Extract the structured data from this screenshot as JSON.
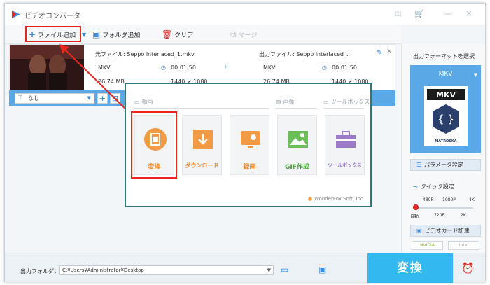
{
  "window": {
    "title": "ビデオコンバータ"
  },
  "toolbar": {
    "add_file": "ファイル追加",
    "add_folder": "フォルダ追加",
    "clear": "クリア",
    "merge": "マージ"
  },
  "file": {
    "source_name": "元ファイル: Seppo interlaced_1.mkv",
    "source_format": "MKV",
    "source_duration": "00:01:50",
    "source_size": "26.74 MB",
    "source_res": "1440 × 1080",
    "output_name": "出力ファイル: Seppo interlaced_...",
    "output_format": "MKV",
    "output_duration": "00:01:50",
    "output_size": "26.74 MB",
    "output_res": "1440 × 1080"
  },
  "options": {
    "subtitle_select": "なし"
  },
  "popup": {
    "section_video": "動画",
    "section_image": "画像",
    "section_toolbox": "ツールボックス",
    "cards": [
      {
        "label": "変換"
      },
      {
        "label": "ダウンロード"
      },
      {
        "label": "録画"
      },
      {
        "label": "GIF作成"
      },
      {
        "label": "ツールボックス"
      }
    ],
    "brand": "WonderFox Soft, Inc."
  },
  "right_panel": {
    "title": "出力フォーマットを選択",
    "format": "MKV",
    "param_button": "パラメータ設定",
    "quick_setting": "クイック設定",
    "quality_top": [
      "480P",
      "1080P",
      "4K"
    ],
    "quality_bottom": [
      "自動",
      "720P",
      "2K"
    ],
    "quality_level": 0,
    "gpu_button": "ビデオカード加速",
    "gpu_chips": [
      "NVIDIA",
      "Intel"
    ]
  },
  "bottom": {
    "output_folder_label": "出力フォルダ：",
    "output_path": "C:¥Users¥Administrator¥Desktop",
    "convert_label": "変換"
  },
  "colors": {
    "accent": "#5aa9e6",
    "convert": "#33b9f0",
    "highlight": "#e8261f",
    "popup_border": "#2b7a7a"
  }
}
